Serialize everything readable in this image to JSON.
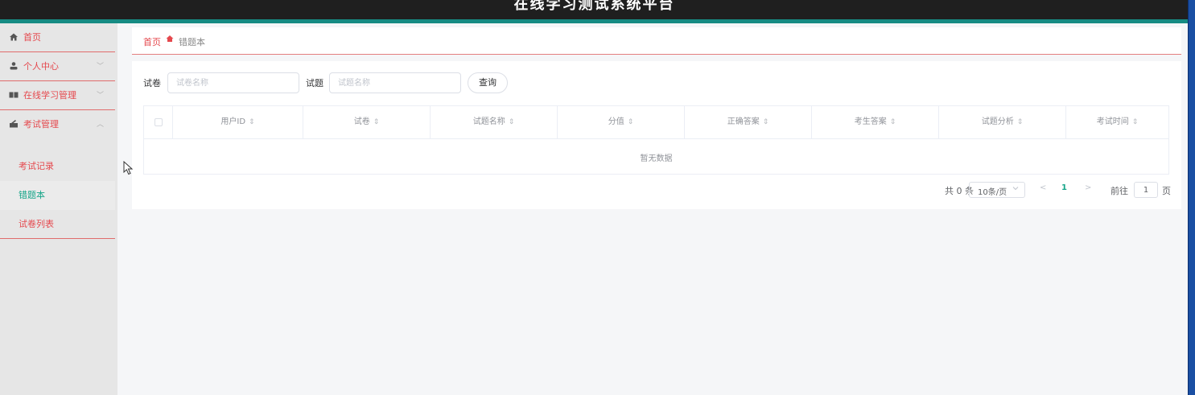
{
  "header": {
    "title": "在线学习测试系统平台"
  },
  "sidebar": {
    "items": [
      {
        "label": "首页",
        "icon": "home-icon"
      },
      {
        "label": "个人中心",
        "icon": "user-icon",
        "caret": "﹀"
      },
      {
        "label": "在线学习管理",
        "icon": "book-icon",
        "caret": "﹀"
      },
      {
        "label": "考试管理",
        "icon": "exam-icon",
        "caret": "︿"
      }
    ],
    "sub_items": [
      {
        "label": "考试记录"
      },
      {
        "label": "错题本"
      },
      {
        "label": "试卷列表"
      }
    ]
  },
  "breadcrumb": {
    "home": "首页",
    "current": "错题本"
  },
  "filters": {
    "paper_label": "试卷",
    "paper_placeholder": "试卷名称",
    "question_label": "试题",
    "question_placeholder": "试题名称",
    "query_button": "查询"
  },
  "table": {
    "columns": [
      {
        "label": "用户ID"
      },
      {
        "label": "试卷"
      },
      {
        "label": "试题名称"
      },
      {
        "label": "分值"
      },
      {
        "label": "正确答案"
      },
      {
        "label": "考生答案"
      },
      {
        "label": "试题分析"
      },
      {
        "label": "考试时间"
      }
    ],
    "sort_glyph": "⇕",
    "empty_text": "暂无数据"
  },
  "pagination": {
    "total": "共 0 条",
    "page_size": "10条/页",
    "prev": "<",
    "page": "1",
    "next": ">",
    "goto": "前往",
    "jump_value": "1",
    "unit": "页"
  },
  "colors": {
    "accent_red": "#e5484d",
    "accent_green": "#17a589",
    "header_bg": "#1f1f1f",
    "header_border": "#168b83"
  }
}
